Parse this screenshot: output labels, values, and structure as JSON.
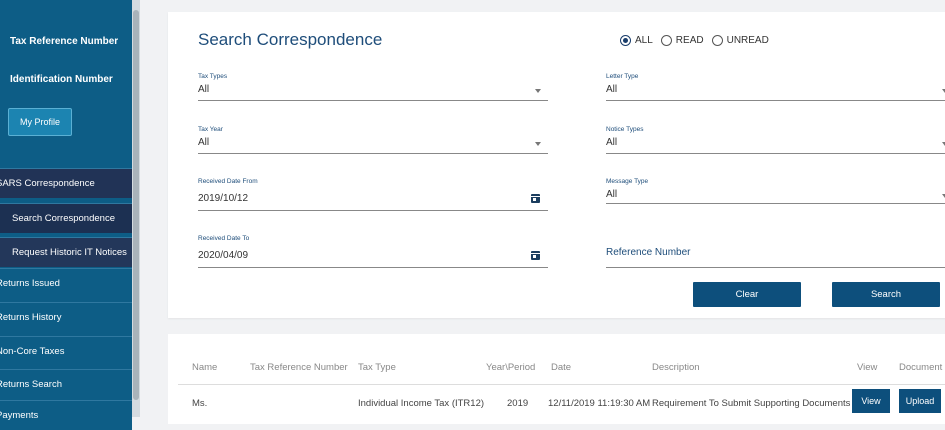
{
  "sidebar": {
    "tax_reference_label": "Tax Reference Number",
    "identification_label": "Identification Number",
    "profile_button": "My Profile",
    "items": [
      {
        "label": "SARS Correspondence"
      },
      {
        "label": "Search Correspondence"
      },
      {
        "label": "Request Historic IT Notices"
      },
      {
        "label": "Returns Issued"
      },
      {
        "label": "Returns History"
      },
      {
        "label": "Non-Core Taxes"
      },
      {
        "label": "Returns Search"
      },
      {
        "label": "Payments"
      }
    ]
  },
  "search": {
    "title": "Search Correspondence",
    "filter": {
      "options": [
        "ALL",
        "READ",
        "UNREAD"
      ],
      "selected": "ALL"
    },
    "fields": {
      "tax_types": {
        "label": "Tax Types",
        "value": "All"
      },
      "letter_type": {
        "label": "Letter Type",
        "value": "All"
      },
      "tax_year": {
        "label": "Tax Year",
        "value": "All"
      },
      "notice_types": {
        "label": "Notice Types",
        "value": "All"
      },
      "date_from": {
        "label": "Received Date From",
        "value": "2019/10/12"
      },
      "message_type": {
        "label": "Message Type",
        "value": "All"
      },
      "date_to": {
        "label": "Received Date To",
        "value": "2020/04/09"
      },
      "reference_number": {
        "label": "Reference Number"
      }
    },
    "clear_button": "Clear",
    "search_button": "Search"
  },
  "results": {
    "columns": [
      "Name",
      "Tax Reference Number",
      "Tax Type",
      "Year\\Period",
      "Date",
      "Description",
      "View",
      "Document"
    ],
    "rows": [
      {
        "name": "Ms.",
        "tax_reference": "",
        "tax_type": "Individual Income Tax (ITR12)",
        "year_period": "2019",
        "date": "12/11/2019 11:19:30 AM",
        "description": "Requirement To Submit Supporting Documents",
        "view_button": "View",
        "document_button": "Upload"
      }
    ]
  },
  "colors": {
    "sidebar_bg": "#0d5d86",
    "sidebar_sub_bg": "#23375a",
    "primary_button": "#0d4f7c",
    "title_color": "#1e4d7a"
  }
}
